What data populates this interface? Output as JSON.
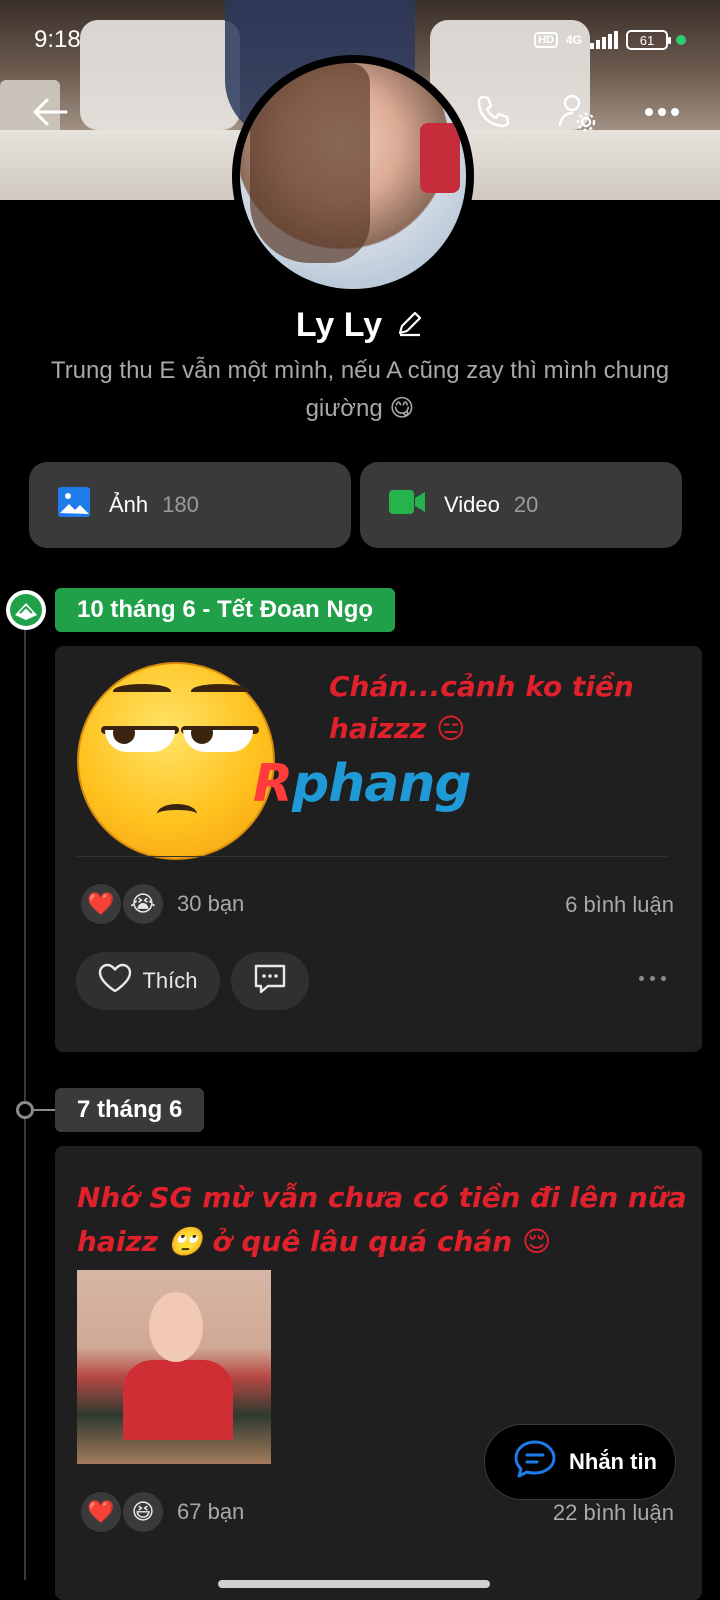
{
  "status_bar": {
    "time": "9:18",
    "hd": "HD",
    "network": "4G",
    "battery": "61"
  },
  "profile": {
    "name": "Ly Ly",
    "bio": "Trung thu E vẫn một mình, nếu A cũng zay thì mình chung giường 😋"
  },
  "media_buttons": [
    {
      "label": "Ảnh",
      "count": "180",
      "icon": "photo-icon",
      "color": "#1f7bea"
    },
    {
      "label": "Video",
      "count": "20",
      "icon": "video-icon",
      "color": "#27b34c"
    }
  ],
  "posts": [
    {
      "date_label": "10 tháng 6 - Tết Đoan Ngọ",
      "text": "Chán...cảnh ko tiền haizzz 😑",
      "watermark_r": "R",
      "watermark_rest": "phang",
      "reactions": [
        "❤️",
        "😭"
      ],
      "reaction_count": "30 bạn",
      "comment_count": "6 bình luận",
      "like_label": "Thích"
    },
    {
      "date_label": "7 tháng 6",
      "text": "Nhớ SG mừ vẫn chưa có tiền đi lên nữa haizz 🙄 ở quê lâu quá chán 😌",
      "reactions": [
        "❤️",
        "😆"
      ],
      "reaction_count": "67 bạn",
      "comment_count": "22 bình luận"
    }
  ],
  "fab": {
    "label": "Nhắn tin",
    "icon": "chat-icon"
  },
  "colors": {
    "accent_green": "#21a04a",
    "post_text": "#e0212b",
    "card_bg": "#1f1f1f"
  }
}
